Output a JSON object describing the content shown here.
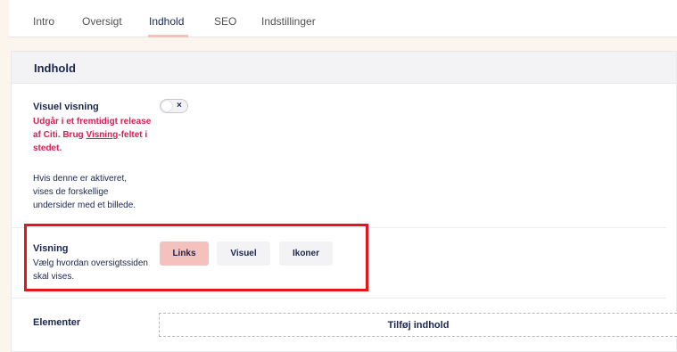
{
  "tabs": [
    {
      "label": "Intro"
    },
    {
      "label": "Oversigt"
    },
    {
      "label": "Indhold"
    },
    {
      "label": "SEO"
    },
    {
      "label": "Indstillinger"
    }
  ],
  "active_tab": "Indhold",
  "panel": {
    "title": "Indhold",
    "visuel_visning": {
      "label": "Visuel visning",
      "warning_part1": "Udgår i et fremtidigt release af Citi. Brug ",
      "warning_link": "Visning",
      "warning_part2": "-feltet i stedet.",
      "description": "Hvis denne er aktiveret, vises de forskellige undersider med et billede.",
      "toggle_symbol": "×",
      "toggle_on": false
    },
    "visning": {
      "label": "Visning",
      "description": "Vælg hvordan oversigtssiden skal vises.",
      "options": [
        "Links",
        "Visuel",
        "Ikoner"
      ],
      "selected": "Links"
    },
    "elementer": {
      "label": "Elementer",
      "add_label": "Tilføj indhold"
    }
  },
  "colors": {
    "accent": "#f5c1bc",
    "warning": "#d42054",
    "highlight": "#e8141b",
    "text": "#1b264f"
  }
}
